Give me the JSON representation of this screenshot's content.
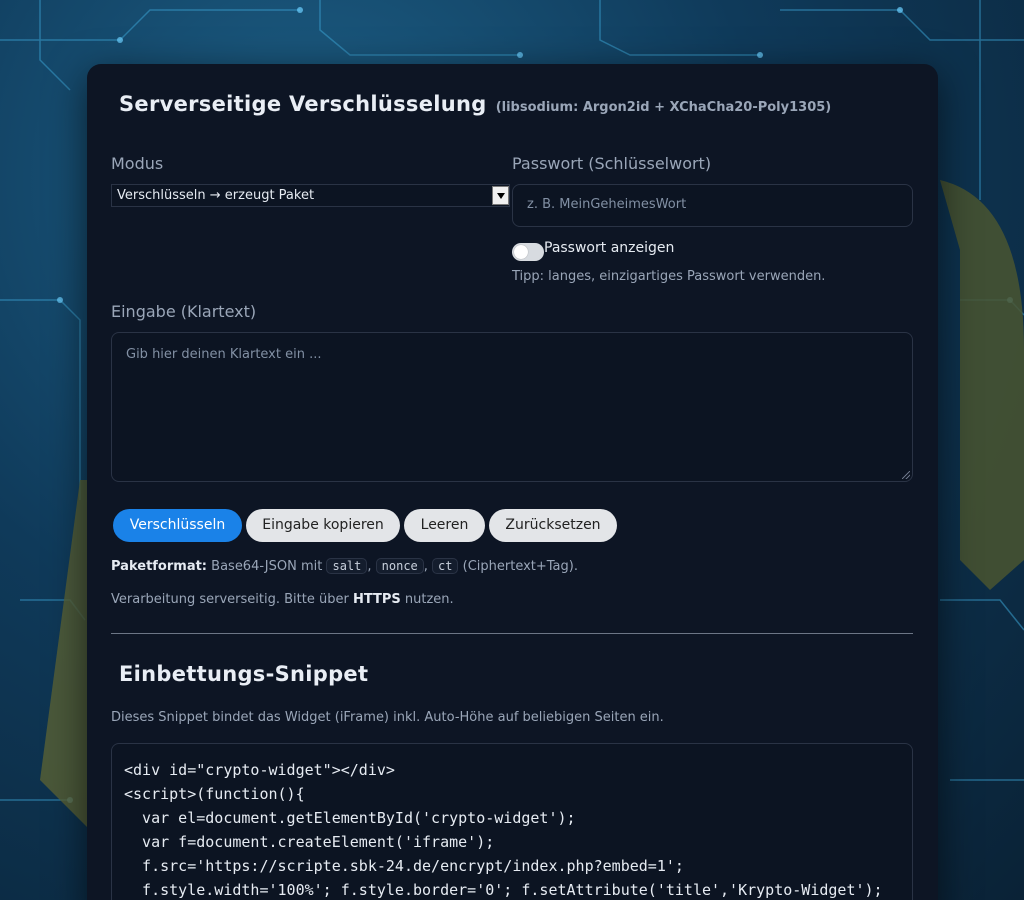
{
  "header": {
    "title": "Serverseitige Verschlüsselung",
    "subtitle": "(libsodium: Argon2id + XChaCha20-Poly1305)"
  },
  "mode": {
    "label": "Modus",
    "selected": "Verschlüsseln → erzeugt Paket"
  },
  "password": {
    "label": "Passwort (Schlüsselwort)",
    "placeholder": "z. B. MeinGeheimesWort",
    "show_label": "Passwort anzeigen",
    "show_checked": false,
    "tip": "Tipp: langes, einzigartiges Passwort verwenden."
  },
  "input": {
    "label": "Eingabe (Klartext)",
    "placeholder": "Gib hier deinen Klartext ein ..."
  },
  "buttons": {
    "encrypt": "Verschlüsseln",
    "copy": "Eingabe kopieren",
    "clear": "Leeren",
    "reset": "Zurücksetzen"
  },
  "format_note": {
    "bold": "Paketformat:",
    "text": "Base64-JSON mit",
    "tags": [
      "salt",
      "nonce",
      "ct"
    ],
    "suffix": "(Ciphertext+Tag)."
  },
  "server_note": {
    "prefix": "Verarbeitung serverseitig. Bitte über",
    "bold": "HTTPS",
    "suffix": "nutzen."
  },
  "embed": {
    "title": "Einbettungs-Snippet",
    "description": "Dieses Snippet bindet das Widget (iFrame) inkl. Auto-Höhe auf beliebigen Seiten ein.",
    "code_lines": [
      "<div id=\"crypto-widget\"></div>",
      "<script>(function(){",
      "  var el=document.getElementById('crypto-widget');",
      "  var f=document.createElement('iframe');",
      "  f.src='https://scripte.sbk-24.de/encrypt/index.php?embed=1';",
      "  f.style.width='100%'; f.style.border='0'; f.setAttribute('title','Krypto-Widget');"
    ]
  },
  "colors": {
    "accent": "#1a82e8",
    "card_bg": "#0d1524",
    "page_bg": "#0f3a5a"
  }
}
